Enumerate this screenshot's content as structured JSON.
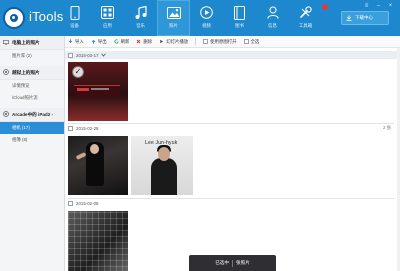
{
  "app": {
    "name": "iTools"
  },
  "nav": [
    {
      "label": "设备",
      "icon": "device-icon"
    },
    {
      "label": "应用",
      "icon": "apps-icon"
    },
    {
      "label": "音乐",
      "icon": "music-icon"
    },
    {
      "label": "照片",
      "icon": "photos-icon",
      "active": true
    },
    {
      "label": "视频",
      "icon": "video-icon"
    },
    {
      "label": "图书",
      "icon": "books-icon"
    },
    {
      "label": "信息",
      "icon": "contacts-icon"
    },
    {
      "label": "工具箱",
      "icon": "toolbox-icon"
    }
  ],
  "header": {
    "download_label": "下载中心"
  },
  "window_controls": {
    "menu": "≡",
    "minimize": "–",
    "close": "×"
  },
  "sidebar": {
    "group1": {
      "label": "电脑上的照片"
    },
    "group1_items": [
      {
        "label": "图片库 (2)"
      }
    ],
    "group2": {
      "label": "越狱上的照片"
    },
    "group2_items": [
      {
        "label": "详情预览"
      },
      {
        "label": "iCloud照片流"
      }
    ],
    "group3": {
      "label": "Arcade中的 iPad2 -"
    },
    "group3_items": [
      {
        "label": "相机 (17)",
        "selected": true
      },
      {
        "label": "相簿 (8)"
      }
    ]
  },
  "toolbar": {
    "import": "导入",
    "export": "导出",
    "refresh": "刷新",
    "delete": "删除",
    "slideshow": "幻灯片播放",
    "download_original": "使用原图打开",
    "select_all": "全选"
  },
  "sections": [
    {
      "date": "2015-03-17",
      "count": ""
    },
    {
      "date": "2015-02-28",
      "count": "2 张"
    },
    {
      "date": "2015-02-08",
      "count": ""
    }
  ],
  "photo_text": {
    "poster_title": "Lee Jun-hyuk"
  },
  "status": {
    "left": "已选中",
    "right": "张照片"
  },
  "colors": {
    "accent": "#1e88cf",
    "selected": "#2b8ed6"
  }
}
